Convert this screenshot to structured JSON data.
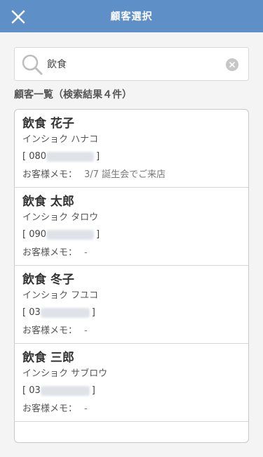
{
  "header": {
    "title": "顧客選択",
    "close_icon": "close-icon",
    "background": "#5e8fc7"
  },
  "search": {
    "value": "飲食",
    "placeholder": "",
    "icon": "search-icon",
    "clear_icon": "clear-icon"
  },
  "list": {
    "heading": "顧客一覧（検索結果４件）",
    "memo_label": "お客様メモ：",
    "items": [
      {
        "name": "飲食 花子",
        "kana": "インショク ハナコ",
        "phone_open": "[ 080",
        "phone_close": "]",
        "memo": "3/7 誕生会でご来店"
      },
      {
        "name": "飲食 太郎",
        "kana": "インショク タロウ",
        "phone_open": "[ 090",
        "phone_close": "]",
        "memo": "-"
      },
      {
        "name": "飲食 冬子",
        "kana": "インショク フユコ",
        "phone_open": "[ 03",
        "phone_close": "]",
        "memo": "-"
      },
      {
        "name": "飲食 三郎",
        "kana": "インショク サブロウ",
        "phone_open": "[ 03",
        "phone_close": "]",
        "memo": "-"
      }
    ]
  }
}
